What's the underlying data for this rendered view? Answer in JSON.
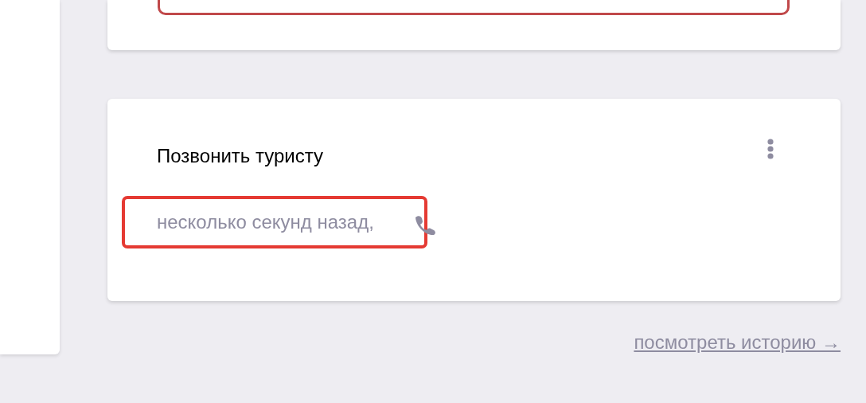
{
  "task_card": {
    "title": "Позвонить туристу",
    "time": "несколько секунд назад,"
  },
  "history_link": "посмотреть историю →"
}
